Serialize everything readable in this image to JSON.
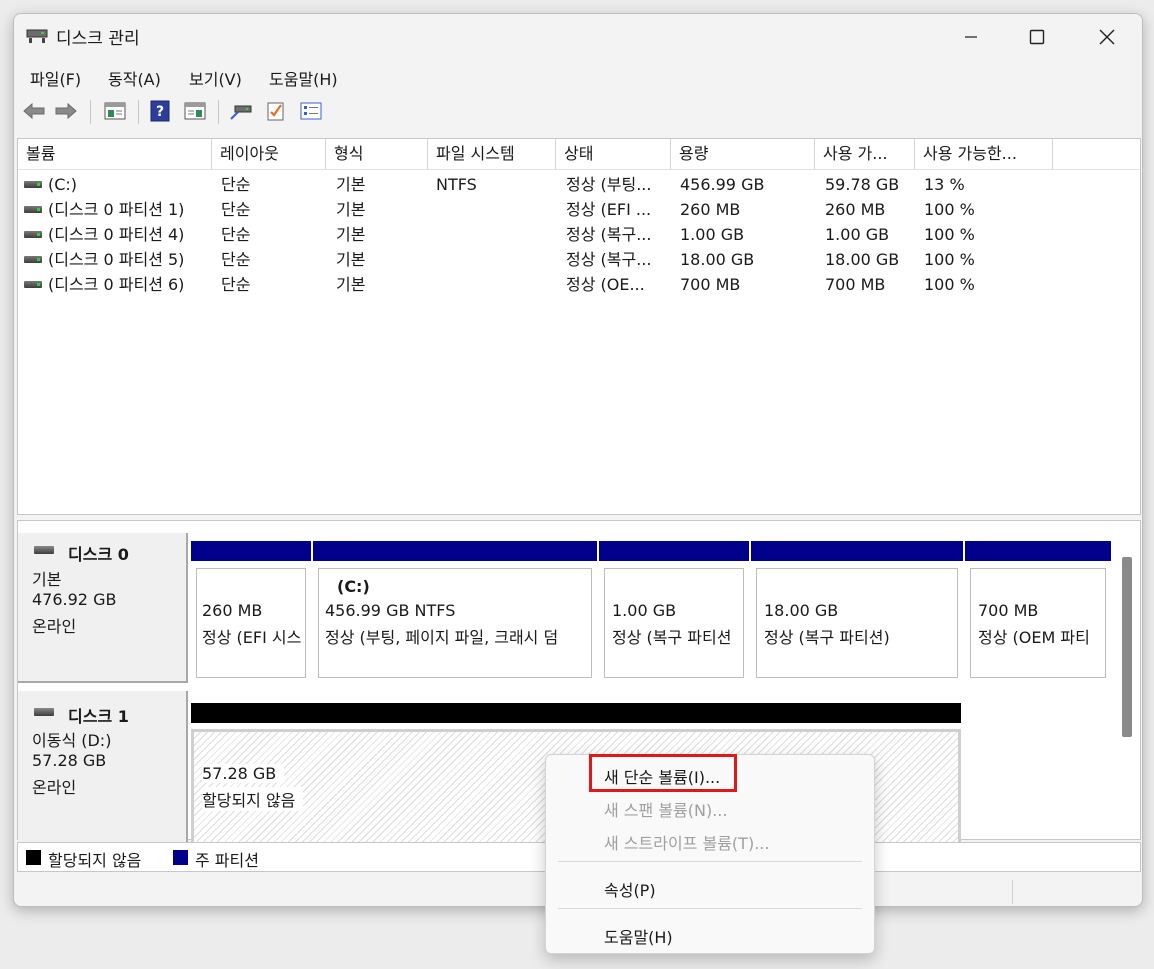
{
  "window": {
    "title": "디스크 관리"
  },
  "menu": [
    "파일(F)",
    "동작(A)",
    "보기(V)",
    "도움말(H)"
  ],
  "columns": [
    "볼륨",
    "레이아웃",
    "형식",
    "파일 시스템",
    "상태",
    "용량",
    "사용 가...",
    "사용 가능한..."
  ],
  "rows": [
    {
      "volume": "(C:)",
      "layout": "단순",
      "type": "기본",
      "fs": "NTFS",
      "status": "정상 (부팅...",
      "capacity": "456.99 GB",
      "free": "59.78 GB",
      "pct": "13 %"
    },
    {
      "volume": "(디스크 0 파티션 1)",
      "layout": "단순",
      "type": "기본",
      "fs": "",
      "status": "정상 (EFI ...",
      "capacity": "260 MB",
      "free": "260 MB",
      "pct": "100 %"
    },
    {
      "volume": "(디스크 0 파티션 4)",
      "layout": "단순",
      "type": "기본",
      "fs": "",
      "status": "정상 (복구...",
      "capacity": "1.00 GB",
      "free": "1.00 GB",
      "pct": "100 %"
    },
    {
      "volume": "(디스크 0 파티션 5)",
      "layout": "단순",
      "type": "기본",
      "fs": "",
      "status": "정상 (복구...",
      "capacity": "18.00 GB",
      "free": "18.00 GB",
      "pct": "100 %"
    },
    {
      "volume": "(디스크 0 파티션 6)",
      "layout": "단순",
      "type": "기본",
      "fs": "",
      "status": "정상 (OE...",
      "capacity": "700 MB",
      "free": "700 MB",
      "pct": "100 %"
    }
  ],
  "disk0": {
    "name": "디스크 0",
    "kind": "기본",
    "size": "476.92 GB",
    "state": "온라인",
    "partitions": [
      {
        "label": "",
        "size": "260 MB",
        "status": "정상 (EFI 시스"
      },
      {
        "label": "(C:)",
        "size": "456.99 GB NTFS",
        "status": "정상 (부팅, 페이지 파일, 크래시 덤"
      },
      {
        "label": "",
        "size": "1.00 GB",
        "status": "정상 (복구 파티션"
      },
      {
        "label": "",
        "size": "18.00 GB",
        "status": "정상 (복구 파티션)"
      },
      {
        "label": "",
        "size": "700 MB",
        "status": "정상 (OEM 파티"
      }
    ]
  },
  "disk1": {
    "name": "디스크 1",
    "kind": "이동식 (D:)",
    "size": "57.28 GB",
    "state": "온라인",
    "unallocated": {
      "size": "57.28 GB",
      "status": "할당되지 않음"
    }
  },
  "legend": [
    {
      "label": "할당되지 않음",
      "color": "#000000"
    },
    {
      "label": "주 파티션",
      "color": "#00008b"
    }
  ],
  "context_menu": {
    "new_simple": "새 단순 볼륨(I)...",
    "new_spanned": "새 스팬 볼륨(N)...",
    "new_striped": "새 스트라이프 볼륨(T)...",
    "properties": "속성(P)",
    "help": "도움말(H)"
  }
}
